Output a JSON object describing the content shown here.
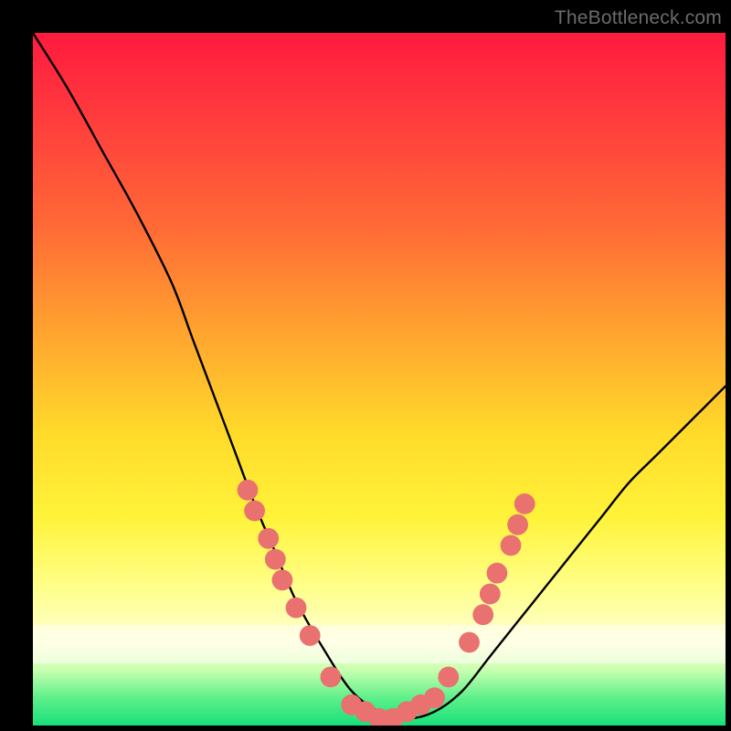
{
  "watermark": "TheBottleneck.com",
  "chart_data": {
    "type": "line",
    "title": "",
    "xlabel": "",
    "ylabel": "",
    "xlim": [
      0,
      100
    ],
    "ylim": [
      0,
      100
    ],
    "grid": false,
    "legend": false,
    "series": [
      {
        "name": "bottleneck-curve",
        "x": [
          0,
          5,
          10,
          15,
          20,
          23,
          26,
          29,
          32,
          35,
          38,
          42,
          46,
          50,
          54,
          58,
          62,
          66,
          70,
          74,
          78,
          82,
          86,
          90,
          94,
          100
        ],
        "values": [
          100,
          92,
          83,
          74,
          64,
          56,
          48,
          40,
          32,
          25,
          18,
          11,
          5,
          2,
          1,
          2,
          5,
          10,
          15,
          20,
          25,
          30,
          35,
          39,
          43,
          49
        ]
      }
    ],
    "markers": {
      "name": "sample-points",
      "color": "#e9716f",
      "radius_pct": 1.5,
      "points": [
        {
          "x": 31,
          "y": 34
        },
        {
          "x": 32,
          "y": 31
        },
        {
          "x": 34,
          "y": 27
        },
        {
          "x": 35,
          "y": 24
        },
        {
          "x": 36,
          "y": 21
        },
        {
          "x": 38,
          "y": 17
        },
        {
          "x": 40,
          "y": 13
        },
        {
          "x": 43,
          "y": 7
        },
        {
          "x": 46,
          "y": 3
        },
        {
          "x": 48,
          "y": 2
        },
        {
          "x": 50,
          "y": 1
        },
        {
          "x": 52,
          "y": 1
        },
        {
          "x": 54,
          "y": 2
        },
        {
          "x": 56,
          "y": 3
        },
        {
          "x": 58,
          "y": 4
        },
        {
          "x": 60,
          "y": 7
        },
        {
          "x": 63,
          "y": 12
        },
        {
          "x": 65,
          "y": 16
        },
        {
          "x": 66,
          "y": 19
        },
        {
          "x": 67,
          "y": 22
        },
        {
          "x": 69,
          "y": 26
        },
        {
          "x": 70,
          "y": 29
        },
        {
          "x": 71,
          "y": 32
        }
      ]
    },
    "background_gradient": {
      "top": "#ff1a3f",
      "bottom": "#18e07a"
    }
  }
}
